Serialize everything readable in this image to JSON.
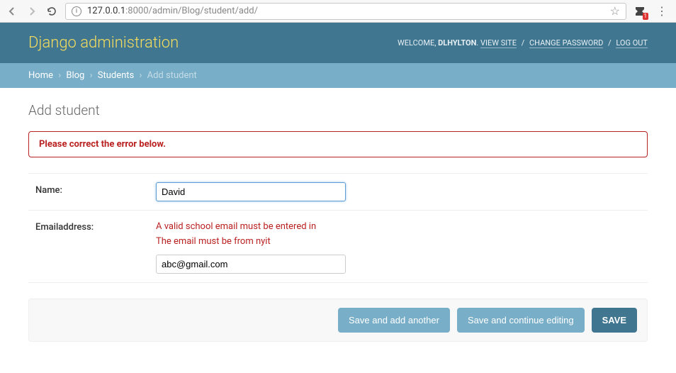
{
  "browser": {
    "url_host": "127.0.0.1",
    "url_port_path": ":8000/admin/Blog/student/add/",
    "ext_badge": "1"
  },
  "header": {
    "branding": "Django administration",
    "welcome": "WELCOME,",
    "username": "DLHYLTON",
    "view_site": "VIEW SITE",
    "change_password": "CHANGE PASSWORD",
    "log_out": "LOG OUT"
  },
  "breadcrumb": {
    "home": "Home",
    "app": "Blog",
    "model": "Students",
    "current": "Add student"
  },
  "page": {
    "title": "Add student",
    "errornote": "Please correct the error below."
  },
  "form": {
    "name_label": "Name:",
    "name_value": "David",
    "email_label": "Emailaddress:",
    "email_value": "abc@gmail.com",
    "email_errors": {
      "e0": "A valid school email must be entered in",
      "e1": "The email must be from nyit"
    }
  },
  "buttons": {
    "save_add": "Save and add another",
    "save_continue": "Save and continue editing",
    "save": "SAVE"
  }
}
